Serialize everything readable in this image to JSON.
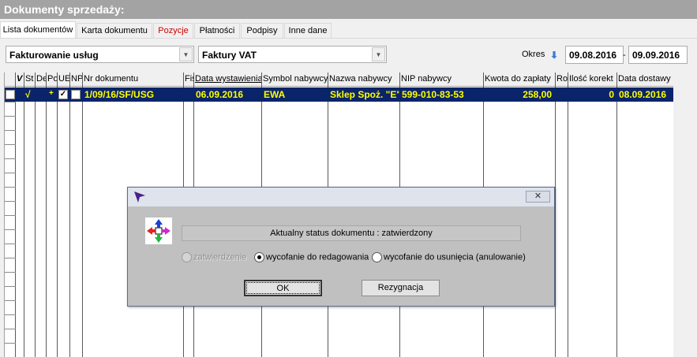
{
  "window": {
    "title": "Dokumenty sprzedaży:"
  },
  "tabs": [
    "Lista dokumentów",
    "Karta dokumentu",
    "Pozycje",
    "Płatności",
    "Podpisy",
    "Inne dane"
  ],
  "filters": {
    "type_value": "Fakturowanie usług",
    "subtype_value": "Faktury VAT",
    "period_label": "Okres",
    "date_from": "09.08.2016",
    "date_sep": "-",
    "date_to": "09.09.2016"
  },
  "table": {
    "columns": [
      "V",
      "St",
      "De",
      "Po",
      "UE",
      "NP",
      "Nr dokumentu",
      "Fis",
      "Data wystawienia",
      "Symbol nabywcy",
      "Nazwa nabywcy",
      "NIP nabywcy",
      "Kwota do zapłaty",
      "Rozliczone",
      "Ilość korekt",
      "Data dostawy"
    ],
    "rows": [
      {
        "st": "√",
        "po": "+",
        "nr": "1/09/16/SF/USG",
        "data_wystawienia": "06.09.2016",
        "symbol": "EWA",
        "nazwa": "Sklep Spoż. \"E\"",
        "nip": "599-010-83-53",
        "kwota": "258,00",
        "ilosc_korekt": "0",
        "data_dostawy": "08.09.2016"
      }
    ]
  },
  "dialog": {
    "close_glyph": "✕",
    "status_text": "Aktualny status dokumentu : zatwierdzony",
    "options": [
      "zatwierdzenie",
      "wycofanie do redagowania",
      "wycofanie do usunięcia (anulowanie)"
    ],
    "ok_label": "OK",
    "cancel_label": "Rezygnacja"
  }
}
